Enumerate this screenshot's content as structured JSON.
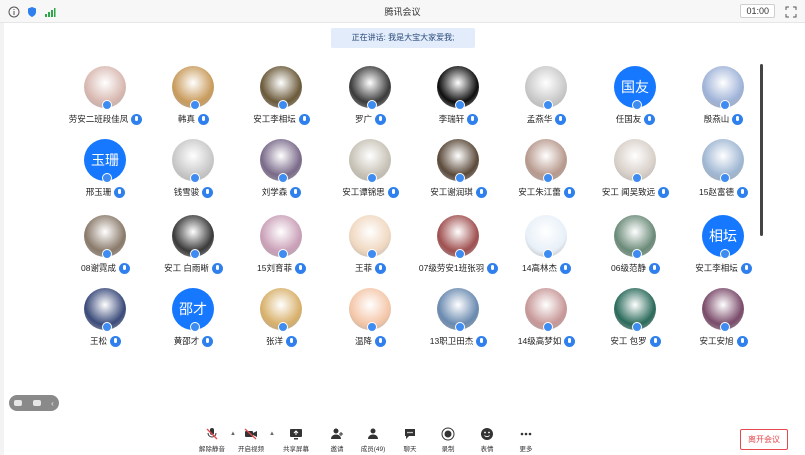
{
  "window": {
    "title": "腾讯会议",
    "timer": "01:00"
  },
  "speaking_banner": "正在讲话: 我是大宝大家爱我;",
  "participants": [
    {
      "name": "劳安二班段佳凤",
      "avatar": "photo",
      "color": "#d8b8b0"
    },
    {
      "name": "韩真",
      "avatar": "photo",
      "color": "#c99b5c"
    },
    {
      "name": "安工李相坛",
      "avatar": "photo",
      "color": "#6b5a3a"
    },
    {
      "name": "罗广",
      "avatar": "photo",
      "color": "#3b3b3b"
    },
    {
      "name": "李瑞轩",
      "avatar": "photo",
      "color": "#0e0e0e"
    },
    {
      "name": "孟燕华",
      "avatar": "photo",
      "color": "#c9c9c9"
    },
    {
      "name": "任国友",
      "avatar": "text",
      "initials": "国友"
    },
    {
      "name": "殷燕山",
      "avatar": "photo",
      "color": "#9fb3d8"
    },
    {
      "name": "邢玉珊",
      "avatar": "text",
      "initials": "玉珊"
    },
    {
      "name": "钱雪骏",
      "avatar": "photo",
      "color": "#c8c8c8"
    },
    {
      "name": "刘学森",
      "avatar": "photo",
      "color": "#7a6a8a"
    },
    {
      "name": "安工谭锦思",
      "avatar": "photo",
      "color": "#c7c2b6"
    },
    {
      "name": "安工谢润琪",
      "avatar": "photo",
      "color": "#5b4a3a"
    },
    {
      "name": "安工朱江蕾",
      "avatar": "photo",
      "color": "#b89a8e"
    },
    {
      "name": "安工 闻吴致远",
      "avatar": "photo",
      "color": "#d8cfc8"
    },
    {
      "name": "15赵富德",
      "avatar": "photo",
      "color": "#9fb7d3"
    },
    {
      "name": "08谢霓成",
      "avatar": "photo",
      "color": "#8a7a6a"
    },
    {
      "name": "安工 白雨晰",
      "avatar": "photo",
      "color": "#3a3a3a"
    },
    {
      "name": "15刘育菲",
      "avatar": "photo",
      "color": "#caa0b8"
    },
    {
      "name": "王菲",
      "avatar": "photo",
      "color": "#f0d8c0"
    },
    {
      "name": "07级劳安1班张羽",
      "avatar": "photo",
      "color": "#a05050"
    },
    {
      "name": "14高林杰",
      "avatar": "photo",
      "color": "#e8f0f8"
    },
    {
      "name": "06级范静",
      "avatar": "photo",
      "color": "#6a8a78"
    },
    {
      "name": "安工李相坛",
      "avatar": "text",
      "initials": "相坛"
    },
    {
      "name": "王松",
      "avatar": "photo",
      "color": "#3a4a7a"
    },
    {
      "name": "黄邵才",
      "avatar": "text",
      "initials": "邵才"
    },
    {
      "name": "张洋",
      "avatar": "photo",
      "color": "#d8b06a"
    },
    {
      "name": "温降",
      "avatar": "photo",
      "color": "#f4c6a8"
    },
    {
      "name": "13职卫田杰",
      "avatar": "photo",
      "color": "#6a8ab0"
    },
    {
      "name": "14级高梦如",
      "avatar": "photo",
      "color": "#c89898"
    },
    {
      "name": "安工 包罗",
      "avatar": "photo",
      "color": "#2a6a5a"
    },
    {
      "name": "安工安旭",
      "avatar": "photo",
      "color": "#7a4a6a"
    }
  ],
  "toolbar": [
    {
      "label": "解除静音",
      "icon": "mic-muted-icon"
    },
    {
      "label": "开启视频",
      "icon": "video-off-icon"
    },
    {
      "label": "共享屏幕",
      "icon": "screen-share-icon"
    },
    {
      "label": "邀请",
      "icon": "invite-icon"
    },
    {
      "label": "成员(49)",
      "icon": "members-icon"
    },
    {
      "label": "聊天",
      "icon": "chat-icon"
    },
    {
      "label": "录制",
      "icon": "record-icon"
    },
    {
      "label": "表情",
      "icon": "emoji-icon"
    },
    {
      "label": "更多",
      "icon": "more-icon"
    }
  ],
  "leave_label": "离开会议",
  "colors": {
    "accent": "#1677ff",
    "leave": "#e5484d"
  }
}
